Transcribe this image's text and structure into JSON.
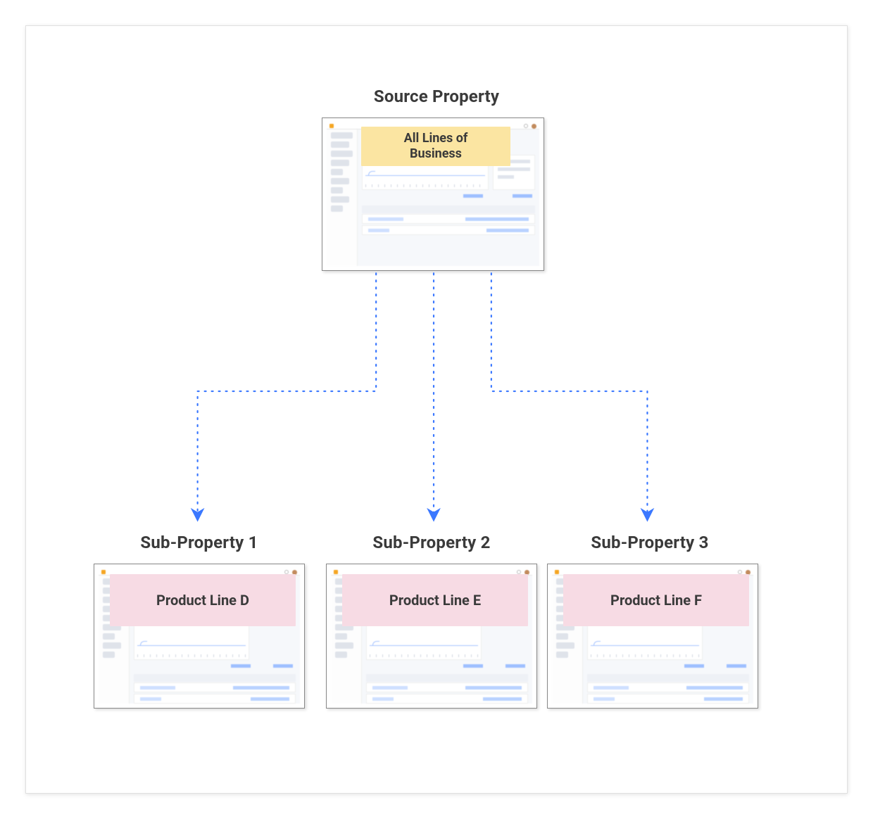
{
  "source": {
    "title": "Source Property",
    "badge": "All Lines of\nBusiness"
  },
  "subs": [
    {
      "title": "Sub-Property 1",
      "badge": "Product Line D"
    },
    {
      "title": "Sub-Property 2",
      "badge": "Product Line E"
    },
    {
      "title": "Sub-Property 3",
      "badge": "Product Line F"
    }
  ],
  "colors": {
    "connector": "#3b78ff",
    "badge_yellow": "#fbe5a2",
    "badge_pink": "#f7dbe4"
  }
}
